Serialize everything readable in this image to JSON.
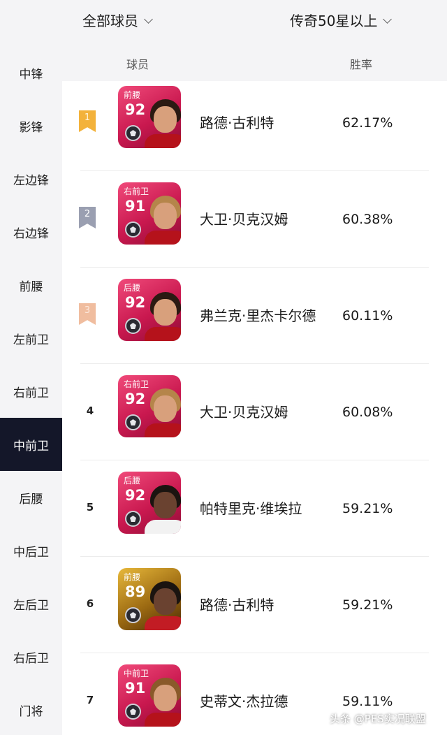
{
  "filters": {
    "player_filter": "全部球员",
    "level_filter": "传奇50星以上"
  },
  "table_header": {
    "player": "球员",
    "win_rate": "胜率"
  },
  "sidebar": {
    "items": [
      {
        "label": "中锋"
      },
      {
        "label": "影锋"
      },
      {
        "label": "左边锋"
      },
      {
        "label": "右边锋"
      },
      {
        "label": "前腰"
      },
      {
        "label": "左前卫"
      },
      {
        "label": "右前卫"
      },
      {
        "label": "中前卫"
      },
      {
        "label": "后腰"
      },
      {
        "label": "中后卫"
      },
      {
        "label": "左后卫"
      },
      {
        "label": "右后卫"
      },
      {
        "label": "门将"
      }
    ],
    "active": "中前卫"
  },
  "rows": [
    {
      "rank": "1",
      "position": "前腰",
      "rating": "92",
      "name": "路德·古利特",
      "win_rate": "62.17%"
    },
    {
      "rank": "2",
      "position": "右前卫",
      "rating": "91",
      "name": "大卫·贝克汉姆",
      "win_rate": "60.38%"
    },
    {
      "rank": "3",
      "position": "后腰",
      "rating": "92",
      "name": "弗兰克·里杰卡尔德",
      "win_rate": "60.11%"
    },
    {
      "rank": "4",
      "position": "右前卫",
      "rating": "92",
      "name": "大卫·贝克汉姆",
      "win_rate": "60.08%"
    },
    {
      "rank": "5",
      "position": "后腰",
      "rating": "92",
      "name": "帕特里克·维埃拉",
      "win_rate": "59.21%"
    },
    {
      "rank": "6",
      "position": "前腰",
      "rating": "89",
      "name": "路德·古利特",
      "win_rate": "59.21%"
    },
    {
      "rank": "7",
      "position": "中前卫",
      "rating": "91",
      "name": "史蒂文·杰拉德",
      "win_rate": "59.11%"
    }
  ],
  "watermark": "头条 @PES实况联盟",
  "colors": {
    "sidebar_active_bg": "#141729",
    "card_pink": "#c9184f",
    "card_gold": "#e7b83a",
    "rank_gold": "#f3b23b",
    "rank_silver": "#9a9fb1",
    "rank_bronze": "#f0bd9f"
  },
  "icons": {
    "dropdown": "chevron-down-icon",
    "card_emblem": "club-emblem-icon"
  }
}
